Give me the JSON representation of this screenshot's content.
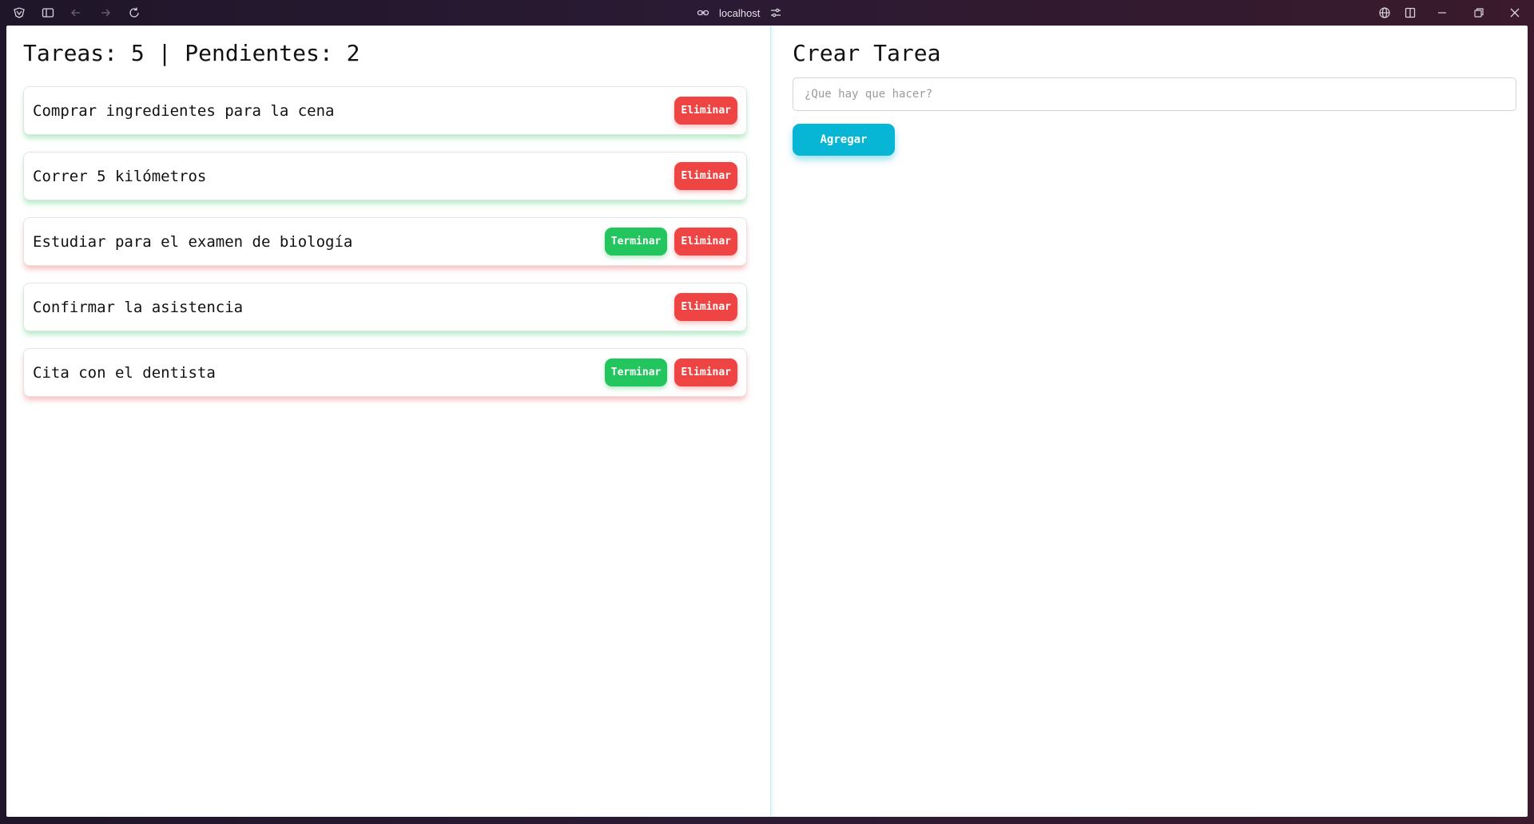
{
  "browser": {
    "address": "localhost",
    "icons": {
      "app": "browser-logo-icon",
      "sidebar": "sidebar-toggle-icon",
      "back": "arrow-left-icon",
      "forward": "arrow-right-icon",
      "reload": "reload-icon",
      "link": "link-icon",
      "site_settings": "sliders-icon",
      "translate": "globe-icon",
      "split_view": "split-view-icon",
      "minimize": "minimize-icon",
      "maximize": "restore-icon",
      "close": "close-icon"
    }
  },
  "task_list": {
    "title": "Tareas: 5 | Pendientes: 2",
    "finish_label": "Terminar",
    "delete_label": "Eliminar",
    "items": [
      {
        "text": "Comprar ingredientes para la cena",
        "completed": true
      },
      {
        "text": "Correr 5 kilómetros",
        "completed": true
      },
      {
        "text": "Estudiar para el examen de biología",
        "completed": false
      },
      {
        "text": "Confirmar la asistencia",
        "completed": true
      },
      {
        "text": "Cita con el dentista",
        "completed": false
      }
    ]
  },
  "create_form": {
    "title": "Crear Tarea",
    "input_value": "",
    "input_placeholder": "¿Que hay que hacer?",
    "add_label": "Agregar"
  },
  "colors": {
    "delete": "#ef4444",
    "finish": "#22c55e",
    "add": "#06b6d4",
    "done_glow": "#22c55e",
    "pending_glow": "#ef4444"
  }
}
